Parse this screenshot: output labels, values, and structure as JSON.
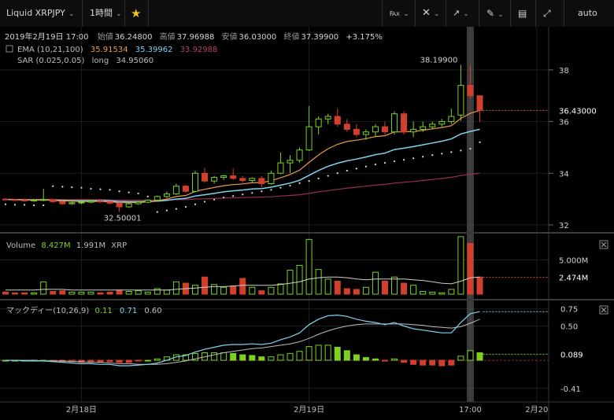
{
  "toolbar": {
    "symbol": "Liquid XRPJPY",
    "interval": "1時間",
    "star_icon": "star-icon",
    "scale_mode": "auto",
    "icons": [
      "candles-icon",
      "crosshair-icon",
      "indicator-icon",
      "draw-pencil-icon",
      "layout-icon",
      "fullscreen-icon"
    ]
  },
  "header": {
    "date": "2019年2月19日 17:00",
    "open_label": "始値",
    "open": "36.24800",
    "high_label": "高値",
    "high": "37.96988",
    "low_label": "安値",
    "low": "36.03000",
    "close_label": "終値",
    "close": "37.39900",
    "change": "+3.175%",
    "ema_label": "EMA (10,21,100)",
    "ema_values": [
      "35.91534",
      "35.39962",
      "33.92988"
    ],
    "sar_label": "SAR (0.025,0.05)",
    "sar_dir": "long",
    "sar_value": "34.95060"
  },
  "colors": {
    "up": "#7cd31f",
    "down": "#d2402d",
    "ema_fast": "#e89a4f",
    "ema_mid": "#7fd3ee",
    "ema_slow": "#9a3047",
    "sar": "#dcdcdc",
    "macd": "#7fd3ee",
    "signal": "#bdbdbd"
  },
  "chart_data": {
    "type": "candlestick",
    "ylim": [
      32,
      39
    ],
    "yticks": [
      32,
      34,
      36,
      38
    ],
    "x_labels": [
      {
        "label": "2月18日",
        "index": 8
      },
      {
        "label": "2月19日",
        "index": 32
      },
      {
        "label": "17:00",
        "index": 49
      },
      {
        "label": "2月20",
        "index": 56
      }
    ],
    "high_annotation": "38.19900",
    "low_annotation": "32.50001",
    "last_price_label": "36.43000",
    "candles": [
      [
        33.0,
        33.04,
        32.96,
        32.98
      ],
      [
        32.98,
        33.0,
        32.94,
        32.96
      ],
      [
        32.96,
        32.99,
        32.92,
        32.94
      ],
      [
        32.94,
        32.98,
        32.9,
        32.96
      ],
      [
        32.96,
        33.4,
        32.92,
        32.98
      ],
      [
        32.98,
        33.0,
        32.86,
        32.9
      ],
      [
        32.9,
        32.94,
        32.78,
        32.82
      ],
      [
        32.82,
        32.9,
        32.78,
        32.86
      ],
      [
        32.86,
        32.92,
        32.8,
        32.88
      ],
      [
        32.88,
        32.96,
        32.84,
        32.92
      ],
      [
        32.92,
        32.96,
        32.86,
        32.9
      ],
      [
        32.9,
        32.92,
        32.8,
        32.84
      ],
      [
        32.84,
        32.88,
        32.5,
        32.7
      ],
      [
        32.7,
        32.86,
        32.66,
        32.82
      ],
      [
        32.82,
        32.92,
        32.78,
        32.88
      ],
      [
        32.88,
        32.98,
        32.84,
        32.96
      ],
      [
        32.96,
        33.14,
        32.94,
        33.1
      ],
      [
        33.1,
        33.3,
        33.04,
        33.2
      ],
      [
        33.2,
        33.6,
        33.16,
        33.5
      ],
      [
        33.5,
        33.56,
        33.24,
        33.3
      ],
      [
        33.3,
        34.1,
        33.26,
        34.0
      ],
      [
        34.0,
        34.2,
        33.64,
        33.7
      ],
      [
        33.7,
        33.9,
        33.6,
        33.84
      ],
      [
        33.84,
        33.94,
        33.74,
        33.9
      ],
      [
        33.9,
        34.18,
        33.74,
        33.8
      ],
      [
        33.8,
        33.9,
        33.64,
        33.72
      ],
      [
        33.72,
        33.84,
        33.62,
        33.8
      ],
      [
        33.8,
        33.9,
        33.46,
        33.6
      ],
      [
        33.6,
        34.1,
        33.56,
        34.0
      ],
      [
        34.0,
        34.8,
        33.96,
        34.4
      ],
      [
        34.4,
        34.7,
        34.0,
        34.5
      ],
      [
        34.5,
        35.0,
        34.4,
        34.9
      ],
      [
        34.9,
        36.6,
        34.86,
        35.8
      ],
      [
        35.8,
        36.2,
        35.5,
        36.1
      ],
      [
        36.1,
        36.3,
        35.9,
        36.2
      ],
      [
        36.2,
        36.5,
        35.8,
        35.9
      ],
      [
        35.9,
        36.1,
        35.6,
        35.7
      ],
      [
        35.7,
        35.9,
        35.4,
        35.5
      ],
      [
        35.5,
        35.7,
        35.3,
        35.6
      ],
      [
        35.6,
        35.9,
        35.4,
        35.8
      ],
      [
        35.8,
        36.0,
        35.5,
        35.6
      ],
      [
        35.6,
        36.4,
        35.5,
        36.3
      ],
      [
        36.3,
        36.4,
        35.5,
        35.6
      ],
      [
        35.6,
        36.0,
        35.4,
        35.7
      ],
      [
        35.7,
        36.0,
        35.6,
        35.8
      ],
      [
        35.8,
        36.0,
        35.7,
        35.9
      ],
      [
        35.9,
        36.1,
        35.8,
        36.0
      ],
      [
        36.0,
        36.5,
        35.9,
        36.2
      ],
      [
        36.25,
        38.2,
        36.03,
        37.4
      ],
      [
        37.4,
        38.2,
        36.9,
        37.0
      ],
      [
        37.0,
        37.0,
        36.0,
        36.43
      ]
    ],
    "ema_fast": [
      32.98,
      32.98,
      32.97,
      32.97,
      32.97,
      32.95,
      32.93,
      32.92,
      32.91,
      32.91,
      32.91,
      32.9,
      32.86,
      32.86,
      32.87,
      32.89,
      32.93,
      33.0,
      33.1,
      33.14,
      33.3,
      33.38,
      33.45,
      33.52,
      33.56,
      33.59,
      33.63,
      33.64,
      33.71,
      33.83,
      33.95,
      34.12,
      34.42,
      34.71,
      34.95,
      35.12,
      35.23,
      35.28,
      35.34,
      35.42,
      35.45,
      35.6,
      35.6,
      35.62,
      35.66,
      35.72,
      35.77,
      35.84,
      36.12,
      36.32,
      36.43
    ],
    "ema_mid": [
      32.98,
      32.98,
      32.97,
      32.97,
      32.97,
      32.96,
      32.95,
      32.94,
      32.94,
      32.94,
      32.94,
      32.93,
      32.91,
      32.9,
      32.9,
      32.91,
      32.92,
      32.95,
      33.0,
      33.03,
      33.12,
      33.17,
      33.22,
      33.28,
      33.32,
      33.35,
      33.39,
      33.41,
      33.46,
      33.54,
      33.62,
      33.73,
      33.92,
      34.11,
      34.27,
      34.39,
      34.48,
      34.55,
      34.63,
      34.72,
      34.78,
      34.92,
      34.97,
      35.03,
      35.1,
      35.17,
      35.24,
      35.33,
      35.52,
      35.62,
      35.7
    ],
    "ema_slow": [
      33.0,
      32.99,
      32.99,
      32.99,
      32.99,
      32.99,
      32.98,
      32.98,
      32.98,
      32.98,
      32.98,
      32.97,
      32.96,
      32.96,
      32.96,
      32.96,
      32.96,
      32.97,
      32.98,
      32.98,
      33.0,
      33.01,
      33.02,
      33.04,
      33.05,
      33.06,
      33.07,
      33.08,
      33.09,
      33.12,
      33.14,
      33.17,
      33.22,
      33.28,
      33.33,
      33.38,
      33.42,
      33.46,
      33.5,
      33.54,
      33.57,
      33.62,
      33.65,
      33.68,
      33.72,
      33.76,
      33.8,
      33.84,
      33.91,
      33.96,
      34.0
    ],
    "sar": [
      32.8,
      32.78,
      32.78,
      32.76,
      32.76,
      33.5,
      33.48,
      33.46,
      33.44,
      33.4,
      33.38,
      33.36,
      33.3,
      33.26,
      33.22,
      33.1,
      32.5,
      32.56,
      32.62,
      32.7,
      32.8,
      32.9,
      32.98,
      33.06,
      33.12,
      33.18,
      33.24,
      33.3,
      33.36,
      33.44,
      33.52,
      33.62,
      33.7,
      33.8,
      33.9,
      34.0,
      34.1,
      34.18,
      34.26,
      34.34,
      34.4,
      34.46,
      34.52,
      34.58,
      34.64,
      34.7,
      34.76,
      34.82,
      34.88,
      34.95,
      35.2
    ],
    "volume": {
      "label": "Volume",
      "value_up": "8.427M",
      "value_down": "1.991M",
      "unit": "XRP",
      "yticks": [
        "5.000M"
      ],
      "last_label": "2.474M",
      "ylim": [
        0,
        8.5
      ],
      "values": [
        0.3,
        0.2,
        0.2,
        0.2,
        1.8,
        0.4,
        0.5,
        0.3,
        0.3,
        0.3,
        0.2,
        0.3,
        0.6,
        0.4,
        0.5,
        0.3,
        0.8,
        0.6,
        1.8,
        1.6,
        1.3,
        2.5,
        1.4,
        1.0,
        1.2,
        2.3,
        1.0,
        0.5,
        1.0,
        1.5,
        3.5,
        4.2,
        8.0,
        3.6,
        2.2,
        1.9,
        0.8,
        0.7,
        1.0,
        3.2,
        1.9,
        2.5,
        1.6,
        1.3,
        0.4,
        0.3,
        0.2,
        0.7,
        8.4,
        7.4,
        2.5
      ],
      "ma": [
        0.6,
        0.6,
        0.6,
        0.6,
        0.7,
        0.7,
        0.7,
        0.6,
        0.6,
        0.6,
        0.6,
        0.6,
        0.6,
        0.6,
        0.6,
        0.6,
        0.6,
        0.6,
        0.7,
        0.8,
        0.9,
        1.0,
        1.1,
        1.1,
        1.2,
        1.3,
        1.3,
        1.3,
        1.3,
        1.4,
        1.6,
        1.8,
        2.2,
        2.4,
        2.5,
        2.5,
        2.4,
        2.2,
        2.1,
        2.2,
        2.2,
        2.2,
        2.2,
        2.1,
        2.0,
        1.8,
        1.6,
        1.5,
        1.9,
        2.4,
        2.5
      ]
    },
    "macd": {
      "label": "マックディー(10,26,9)",
      "values_shown": [
        "0.11",
        "0.71",
        "0.60"
      ],
      "yticks": [
        "0.75",
        "0.50",
        "-0.41"
      ],
      "zero_label": "0.089",
      "ylim": [
        -0.55,
        0.85
      ],
      "macd": [
        0.0,
        0.0,
        -0.01,
        -0.01,
        -0.01,
        -0.02,
        -0.03,
        -0.04,
        -0.05,
        -0.05,
        -0.06,
        -0.06,
        -0.08,
        -0.08,
        -0.07,
        -0.06,
        -0.04,
        0.0,
        0.05,
        0.07,
        0.12,
        0.16,
        0.19,
        0.22,
        0.23,
        0.23,
        0.24,
        0.23,
        0.25,
        0.3,
        0.34,
        0.4,
        0.52,
        0.6,
        0.65,
        0.66,
        0.64,
        0.6,
        0.57,
        0.55,
        0.52,
        0.55,
        0.5,
        0.46,
        0.44,
        0.42,
        0.4,
        0.4,
        0.55,
        0.68,
        0.71
      ],
      "signal": [
        0.0,
        0.0,
        0.0,
        0.0,
        -0.01,
        -0.01,
        -0.01,
        -0.02,
        -0.02,
        -0.03,
        -0.03,
        -0.04,
        -0.05,
        -0.05,
        -0.06,
        -0.06,
        -0.06,
        -0.05,
        -0.03,
        -0.01,
        0.02,
        0.05,
        0.08,
        0.11,
        0.13,
        0.15,
        0.17,
        0.18,
        0.2,
        0.22,
        0.24,
        0.27,
        0.32,
        0.38,
        0.43,
        0.47,
        0.5,
        0.52,
        0.53,
        0.53,
        0.53,
        0.53,
        0.53,
        0.52,
        0.51,
        0.49,
        0.48,
        0.47,
        0.49,
        0.54,
        0.6
      ],
      "hist": [
        0.0,
        0.0,
        0.0,
        0.0,
        0.0,
        -0.01,
        -0.02,
        -0.02,
        -0.03,
        -0.02,
        -0.03,
        -0.02,
        -0.03,
        -0.03,
        -0.01,
        0.0,
        0.02,
        0.05,
        0.08,
        0.08,
        0.1,
        0.11,
        0.11,
        0.11,
        0.1,
        0.08,
        0.07,
        0.05,
        0.05,
        0.08,
        0.1,
        0.13,
        0.2,
        0.22,
        0.22,
        0.19,
        0.14,
        0.08,
        0.04,
        0.02,
        -0.01,
        0.02,
        -0.03,
        -0.06,
        -0.07,
        -0.07,
        -0.08,
        -0.07,
        0.06,
        0.14,
        0.11
      ]
    }
  }
}
